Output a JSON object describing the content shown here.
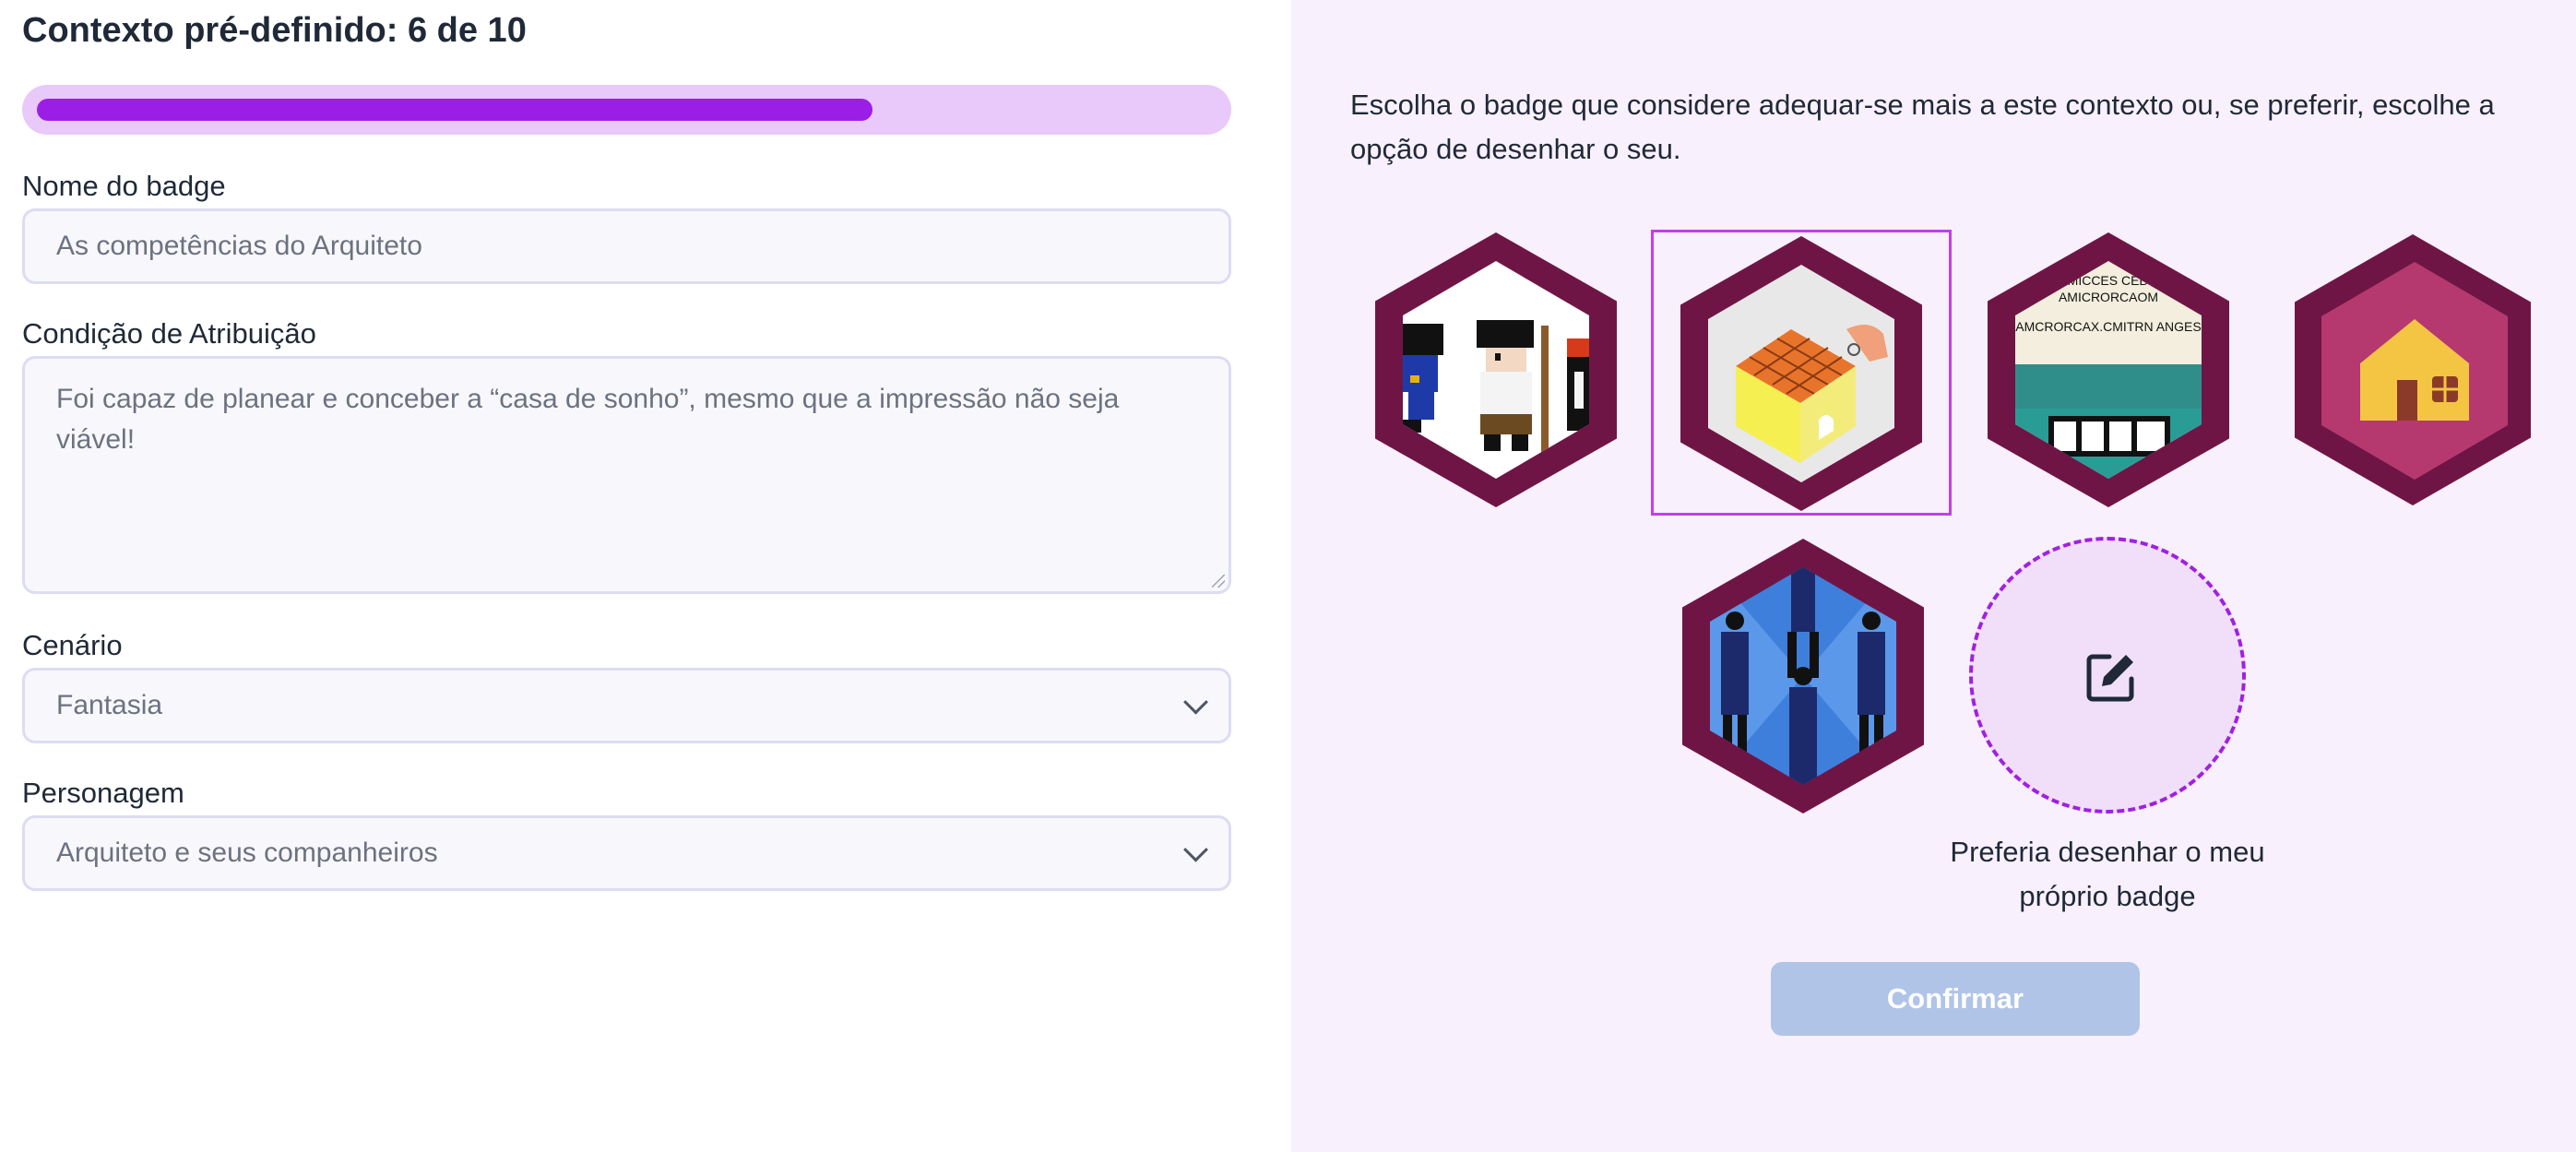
{
  "header": {
    "title": "Contexto pré-definido: 6 de 10"
  },
  "progress": {
    "value": 0.6
  },
  "form": {
    "name_label": "Nome do badge",
    "name_placeholder": "As competências do Arquiteto",
    "condition_label": "Condição de Atribuição",
    "condition_placeholder": "Foi capaz de planear e conceber a “casa de sonho”, mesmo que a impressão não seja viável!",
    "scenario_label": "Cenário",
    "scenario_value": "Fantasia",
    "character_label": "Personagem",
    "character_value": "Arquiteto e seus companheiros"
  },
  "panel": {
    "instructions": "Escolha o badge que considere adequar-se mais a este contexto ou, se preferir, escolhe a opção de desenhar o seu.",
    "badges": [
      {
        "name": "pixel-characters-badge",
        "selected": false
      },
      {
        "name": "building-blocks-badge",
        "selected": true
      },
      {
        "name": "sign-building-badge",
        "selected": false,
        "text_line1": "AMICCES CEBG",
        "text_line2": "AMICRORCAOM",
        "text_line3": "AMCRORCAX.CMITRN ANGES"
      },
      {
        "name": "house-badge",
        "selected": false
      },
      {
        "name": "business-figures-badge",
        "selected": false
      }
    ],
    "draw_option_label": "Preferia desenhar o meu próprio badge",
    "confirm_label": "Confirmar"
  },
  "colors": {
    "accent": "#9b1ee6",
    "progress_track": "#e9c8fa",
    "badge_frame": "#6f1545",
    "panel_bg": "#f9f0fd",
    "confirm_disabled": "#b0c4e7"
  }
}
